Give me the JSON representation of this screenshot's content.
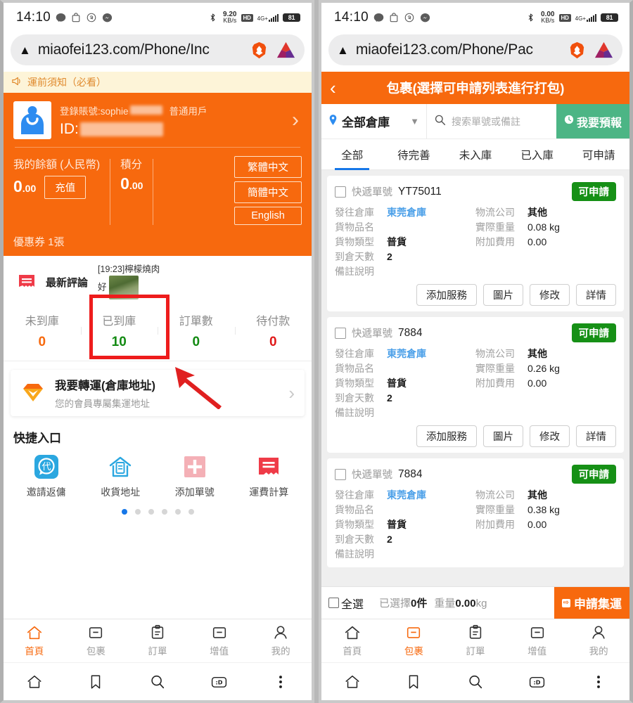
{
  "status_bar": {
    "time": "14:10",
    "left_icons": [
      "line-icon",
      "shopping-bag-icon",
      "threads-icon",
      "messenger-icon"
    ],
    "bluetooth": "bluetooth-icon",
    "net_speed_left": "9.20",
    "net_speed_right": "0.00",
    "speed_unit": "KB/s",
    "hd_badge": "HD",
    "network": "4G+",
    "battery": "81"
  },
  "left": {
    "url": "miaofei123.com/Phone/Inc",
    "warning_icon": "warning-triangle-icon",
    "brave_icon": "brave-lion-icon",
    "bat_icon": "bat-triangle-icon",
    "notice": {
      "icon": "megaphone-icon",
      "text": "運前須知（必看）"
    },
    "user_card": {
      "account_label": "登錄賬號:sophie",
      "user_type": "普通用戶",
      "id_label": "ID:",
      "avatar": "user-avatar-icon",
      "arrow": "›"
    },
    "balance": {
      "balance_label": "我的餘額 (人民幣)",
      "balance_value": "0",
      "balance_decimal": ".00",
      "topup_label": "充值",
      "points_label": "積分",
      "points_value": "0",
      "points_decimal": ".00",
      "coupon_text": "優惠券 1張"
    },
    "languages": [
      "繁體中文",
      "簡體中文",
      "English"
    ],
    "comment": {
      "icon": "receipt-icon",
      "title": "最新評論",
      "time_text": "[19:23]檸檬燒肉",
      "body_text": "好",
      "thumb": "food-photo-thumb"
    },
    "stats": [
      {
        "label": "未到庫",
        "value": "0",
        "color": "#f7690e"
      },
      {
        "label": "已到庫",
        "value": "10",
        "color": "#128a12"
      },
      {
        "label": "訂單數",
        "value": "0",
        "color": "#128a12"
      },
      {
        "label": "待付款",
        "value": "0",
        "color": "#e01919"
      }
    ],
    "annotation": {
      "box_color": "#ee1c1c",
      "arrow_color": "#e02020",
      "highlighted_stat": "已到庫"
    },
    "transfer_card": {
      "icon": "gem-diamond-icon",
      "title": "我要轉運(倉庫地址)",
      "subtitle": "您的會員專屬集運地址",
      "arrow": "›"
    },
    "quick_entry": {
      "heading": "快捷入口",
      "items": [
        {
          "label": "邀請返傭",
          "icon": "commission-icon",
          "glyph": "代",
          "color": "#2ba7e0"
        },
        {
          "label": "收貨地址",
          "icon": "address-house-icon",
          "glyph": "",
          "color": "#2ba7e0"
        },
        {
          "label": "添加單號",
          "icon": "add-plus-icon",
          "glyph": "+",
          "color": "#f4a0a8"
        },
        {
          "label": "運費計算",
          "icon": "freight-calc-icon",
          "glyph": "",
          "color": "#ef3b48"
        }
      ],
      "dots_total": 6,
      "dot_active": 1,
      "dot_active_color": "#1677e8"
    },
    "app_tabs": [
      {
        "label": "首頁",
        "icon": "home-icon",
        "active": true
      },
      {
        "label": "包裹",
        "icon": "package-icon",
        "active": false
      },
      {
        "label": "訂單",
        "icon": "clipboard-icon",
        "active": false
      },
      {
        "label": "增值",
        "icon": "box-icon",
        "active": false
      },
      {
        "label": "我的",
        "icon": "person-icon",
        "active": false
      }
    ]
  },
  "right": {
    "url": "miaofei123.com/Phone/Pac",
    "header": {
      "back_icon": "back-chevron-icon",
      "title": "包裹(選擇可申請列表進行打包)"
    },
    "search": {
      "pin_icon": "location-pin-icon",
      "warehouse": "全部倉庫",
      "caret": "chevron-down-icon",
      "search_icon": "search-icon",
      "placeholder": "搜索單號或備註",
      "forecast_icon": "clock-icon",
      "forecast_label": "我要預報"
    },
    "filter_tabs": [
      {
        "label": "全部",
        "active": true
      },
      {
        "label": "待完善",
        "active": false
      },
      {
        "label": "未入庫",
        "active": false
      },
      {
        "label": "已入庫",
        "active": false
      },
      {
        "label": "可申請",
        "active": false
      }
    ],
    "field_labels": {
      "tracking": "快遞單號",
      "warehouse": "發往倉庫",
      "goods_name": "貨物品名",
      "goods_type": "貨物類型",
      "days": "到倉天數",
      "remark": "備註說明",
      "company": "物流公司",
      "weight": "實際重量",
      "extra_fee": "附加費用"
    },
    "actions": [
      "添加服務",
      "圖片",
      "修改",
      "詳情"
    ],
    "packages": [
      {
        "tracking_prefix": "YT75011",
        "badge": "可申請",
        "warehouse": "東莞倉庫",
        "goods_name": "",
        "goods_type": "普貨",
        "days": "2",
        "remark": "",
        "company": "其他",
        "weight": "0.08 kg",
        "extra_fee": "0.00"
      },
      {
        "tracking_prefix": "7884",
        "badge": "可申請",
        "warehouse": "東莞倉庫",
        "goods_name": "",
        "goods_type": "普貨",
        "days": "2",
        "remark": "",
        "company": "其他",
        "weight": "0.26 kg",
        "extra_fee": "0.00"
      },
      {
        "tracking_prefix": "7884",
        "badge": "可申請",
        "warehouse": "東莞倉庫",
        "goods_name": "",
        "goods_type": "普貨",
        "days": "2",
        "remark": "",
        "company": "其他",
        "weight": "0.38 kg",
        "extra_fee": "0.00"
      }
    ],
    "select_bar": {
      "select_all": "全選",
      "selected_prefix": "已選擇",
      "selected_count": "0",
      "selected_unit": "件",
      "weight_prefix": "重量",
      "weight_value": "0.00",
      "weight_unit": "kg",
      "apply_icon": "shipping-icon",
      "apply_label": "申請集運"
    },
    "app_tabs": [
      {
        "label": "首頁",
        "icon": "home-icon",
        "active": false
      },
      {
        "label": "包裹",
        "icon": "package-icon",
        "active": true
      },
      {
        "label": "訂單",
        "icon": "clipboard-icon",
        "active": false
      },
      {
        "label": "增值",
        "icon": "box-icon",
        "active": false
      },
      {
        "label": "我的",
        "icon": "person-icon",
        "active": false
      }
    ]
  },
  "browser_nav": [
    "home-icon",
    "bookmark-icon",
    "search-icon",
    "brave-rewards-icon",
    "menu-dots-icon"
  ],
  "colors": {
    "brand_orange": "#f7690e",
    "green_badge": "#169016",
    "forecast_green": "#4cb585",
    "tab_blue": "#1677e8",
    "link_blue": "#4a9fe8"
  }
}
